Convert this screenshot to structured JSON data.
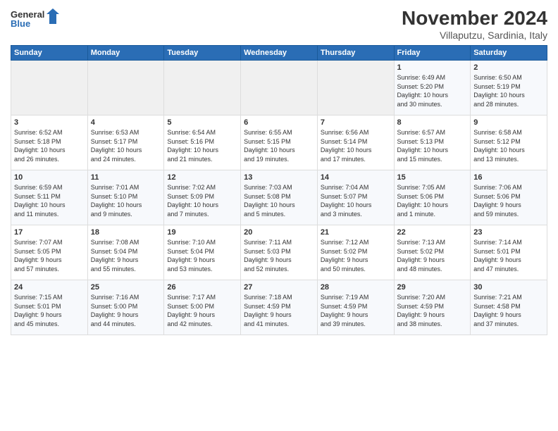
{
  "header": {
    "logo_general": "General",
    "logo_blue": "Blue",
    "month_title": "November 2024",
    "location": "Villaputzu, Sardinia, Italy"
  },
  "weekdays": [
    "Sunday",
    "Monday",
    "Tuesday",
    "Wednesday",
    "Thursday",
    "Friday",
    "Saturday"
  ],
  "weeks": [
    [
      {
        "day": "",
        "info": ""
      },
      {
        "day": "",
        "info": ""
      },
      {
        "day": "",
        "info": ""
      },
      {
        "day": "",
        "info": ""
      },
      {
        "day": "",
        "info": ""
      },
      {
        "day": "1",
        "info": "Sunrise: 6:49 AM\nSunset: 5:20 PM\nDaylight: 10 hours\nand 30 minutes."
      },
      {
        "day": "2",
        "info": "Sunrise: 6:50 AM\nSunset: 5:19 PM\nDaylight: 10 hours\nand 28 minutes."
      }
    ],
    [
      {
        "day": "3",
        "info": "Sunrise: 6:52 AM\nSunset: 5:18 PM\nDaylight: 10 hours\nand 26 minutes."
      },
      {
        "day": "4",
        "info": "Sunrise: 6:53 AM\nSunset: 5:17 PM\nDaylight: 10 hours\nand 24 minutes."
      },
      {
        "day": "5",
        "info": "Sunrise: 6:54 AM\nSunset: 5:16 PM\nDaylight: 10 hours\nand 21 minutes."
      },
      {
        "day": "6",
        "info": "Sunrise: 6:55 AM\nSunset: 5:15 PM\nDaylight: 10 hours\nand 19 minutes."
      },
      {
        "day": "7",
        "info": "Sunrise: 6:56 AM\nSunset: 5:14 PM\nDaylight: 10 hours\nand 17 minutes."
      },
      {
        "day": "8",
        "info": "Sunrise: 6:57 AM\nSunset: 5:13 PM\nDaylight: 10 hours\nand 15 minutes."
      },
      {
        "day": "9",
        "info": "Sunrise: 6:58 AM\nSunset: 5:12 PM\nDaylight: 10 hours\nand 13 minutes."
      }
    ],
    [
      {
        "day": "10",
        "info": "Sunrise: 6:59 AM\nSunset: 5:11 PM\nDaylight: 10 hours\nand 11 minutes."
      },
      {
        "day": "11",
        "info": "Sunrise: 7:01 AM\nSunset: 5:10 PM\nDaylight: 10 hours\nand 9 minutes."
      },
      {
        "day": "12",
        "info": "Sunrise: 7:02 AM\nSunset: 5:09 PM\nDaylight: 10 hours\nand 7 minutes."
      },
      {
        "day": "13",
        "info": "Sunrise: 7:03 AM\nSunset: 5:08 PM\nDaylight: 10 hours\nand 5 minutes."
      },
      {
        "day": "14",
        "info": "Sunrise: 7:04 AM\nSunset: 5:07 PM\nDaylight: 10 hours\nand 3 minutes."
      },
      {
        "day": "15",
        "info": "Sunrise: 7:05 AM\nSunset: 5:06 PM\nDaylight: 10 hours\nand 1 minute."
      },
      {
        "day": "16",
        "info": "Sunrise: 7:06 AM\nSunset: 5:06 PM\nDaylight: 9 hours\nand 59 minutes."
      }
    ],
    [
      {
        "day": "17",
        "info": "Sunrise: 7:07 AM\nSunset: 5:05 PM\nDaylight: 9 hours\nand 57 minutes."
      },
      {
        "day": "18",
        "info": "Sunrise: 7:08 AM\nSunset: 5:04 PM\nDaylight: 9 hours\nand 55 minutes."
      },
      {
        "day": "19",
        "info": "Sunrise: 7:10 AM\nSunset: 5:04 PM\nDaylight: 9 hours\nand 53 minutes."
      },
      {
        "day": "20",
        "info": "Sunrise: 7:11 AM\nSunset: 5:03 PM\nDaylight: 9 hours\nand 52 minutes."
      },
      {
        "day": "21",
        "info": "Sunrise: 7:12 AM\nSunset: 5:02 PM\nDaylight: 9 hours\nand 50 minutes."
      },
      {
        "day": "22",
        "info": "Sunrise: 7:13 AM\nSunset: 5:02 PM\nDaylight: 9 hours\nand 48 minutes."
      },
      {
        "day": "23",
        "info": "Sunrise: 7:14 AM\nSunset: 5:01 PM\nDaylight: 9 hours\nand 47 minutes."
      }
    ],
    [
      {
        "day": "24",
        "info": "Sunrise: 7:15 AM\nSunset: 5:01 PM\nDaylight: 9 hours\nand 45 minutes."
      },
      {
        "day": "25",
        "info": "Sunrise: 7:16 AM\nSunset: 5:00 PM\nDaylight: 9 hours\nand 44 minutes."
      },
      {
        "day": "26",
        "info": "Sunrise: 7:17 AM\nSunset: 5:00 PM\nDaylight: 9 hours\nand 42 minutes."
      },
      {
        "day": "27",
        "info": "Sunrise: 7:18 AM\nSunset: 4:59 PM\nDaylight: 9 hours\nand 41 minutes."
      },
      {
        "day": "28",
        "info": "Sunrise: 7:19 AM\nSunset: 4:59 PM\nDaylight: 9 hours\nand 39 minutes."
      },
      {
        "day": "29",
        "info": "Sunrise: 7:20 AM\nSunset: 4:59 PM\nDaylight: 9 hours\nand 38 minutes."
      },
      {
        "day": "30",
        "info": "Sunrise: 7:21 AM\nSunset: 4:58 PM\nDaylight: 9 hours\nand 37 minutes."
      }
    ]
  ]
}
